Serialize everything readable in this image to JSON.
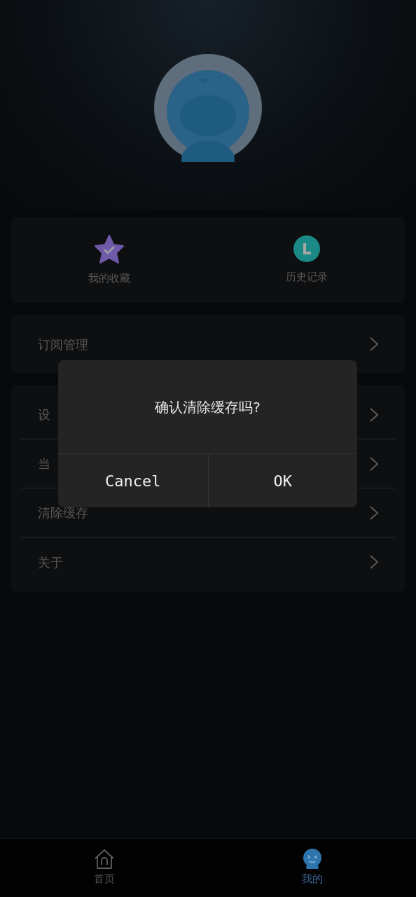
{
  "shortcuts": [
    {
      "kind": "star",
      "label": "我的收藏"
    },
    {
      "kind": "clock",
      "label": "历史记录"
    }
  ],
  "menu_groups": [
    {
      "items": [
        {
          "label": "订阅管理"
        }
      ]
    },
    {
      "items": [
        {
          "label": "设"
        },
        {
          "label": "当"
        },
        {
          "label": "清除缓存"
        },
        {
          "label": "关于"
        }
      ]
    }
  ],
  "dialog": {
    "message": "确认清除缓存吗?",
    "buttons": [
      "Cancel",
      "OK"
    ]
  },
  "bottom_nav": [
    {
      "kind": "home",
      "label": "首页",
      "selected": false
    },
    {
      "kind": "mascot",
      "label": "我的",
      "selected": true
    }
  ]
}
